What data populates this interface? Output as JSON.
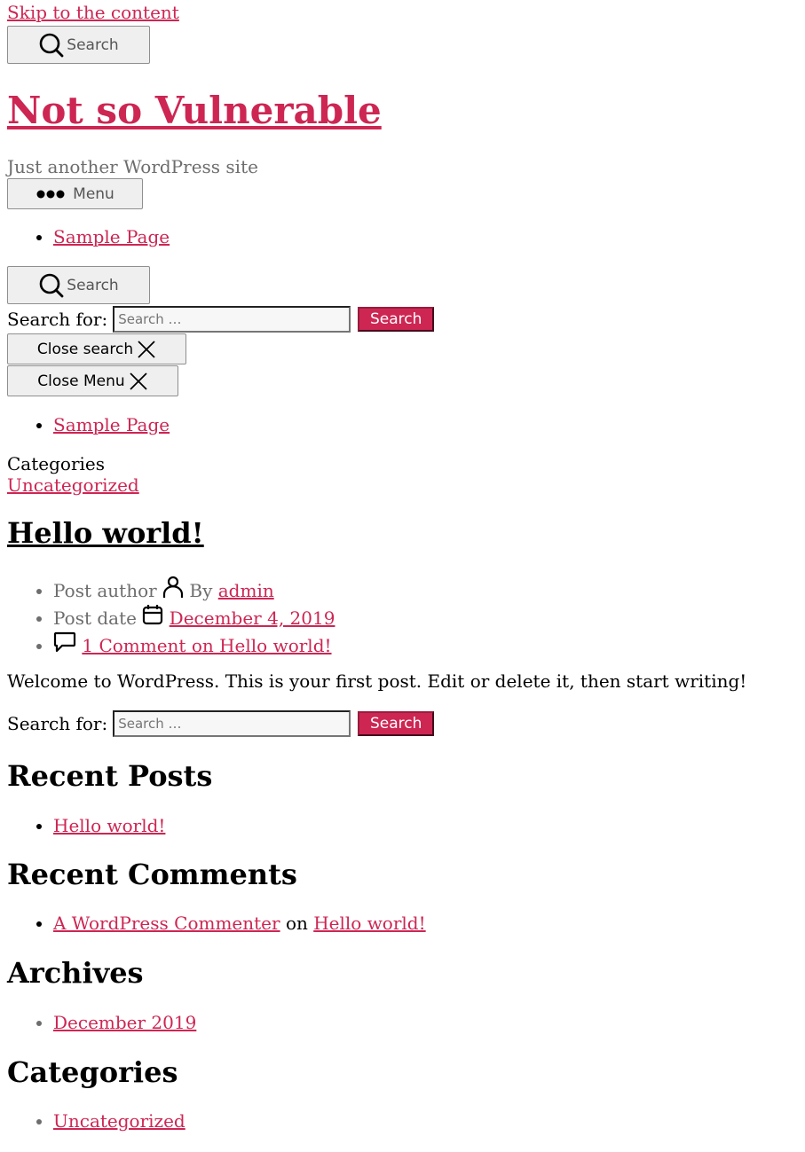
{
  "skip_link": "Skip to the content",
  "header": {
    "search_toggle_label": "Search",
    "site_title": "Not so Vulnerable",
    "site_description": "Just another WordPress site",
    "menu_toggle_label": "Menu"
  },
  "primary_menu": {
    "items": [
      "Sample Page"
    ]
  },
  "search_modal": {
    "toggle_label": "Search",
    "form": {
      "label": "Search for:",
      "placeholder": "Search …",
      "submit": "Search"
    },
    "close_label": "Close search"
  },
  "menu_modal": {
    "close_label": "Close Menu",
    "items": [
      "Sample Page"
    ]
  },
  "post": {
    "categories_label": "Categories",
    "category": "Uncategorized",
    "title": "Hello world!",
    "author_label": "Post author",
    "by_label": "By",
    "author": "admin",
    "date_label": "Post date",
    "date": "December 4, 2019",
    "comments_link": "1 Comment on Hello world!",
    "content": "Welcome to WordPress. This is your first post. Edit or delete it, then start writing!"
  },
  "widget_search": {
    "label": "Search for:",
    "placeholder": "Search …",
    "submit": "Search"
  },
  "widgets": {
    "recent_posts": {
      "title": "Recent Posts",
      "items": [
        "Hello world!"
      ]
    },
    "recent_comments": {
      "title": "Recent Comments",
      "items": [
        {
          "author": "A WordPress Commenter",
          "connector": "on",
          "post": "Hello world!"
        }
      ]
    },
    "archives": {
      "title": "Archives",
      "items": [
        "December 2019"
      ]
    },
    "categories": {
      "title": "Categories",
      "items": [
        "Uncategorized"
      ]
    }
  },
  "colors": {
    "accent": "#cd2653",
    "meta_gray": "#6d6d6d",
    "button_bg": "#efefef"
  }
}
